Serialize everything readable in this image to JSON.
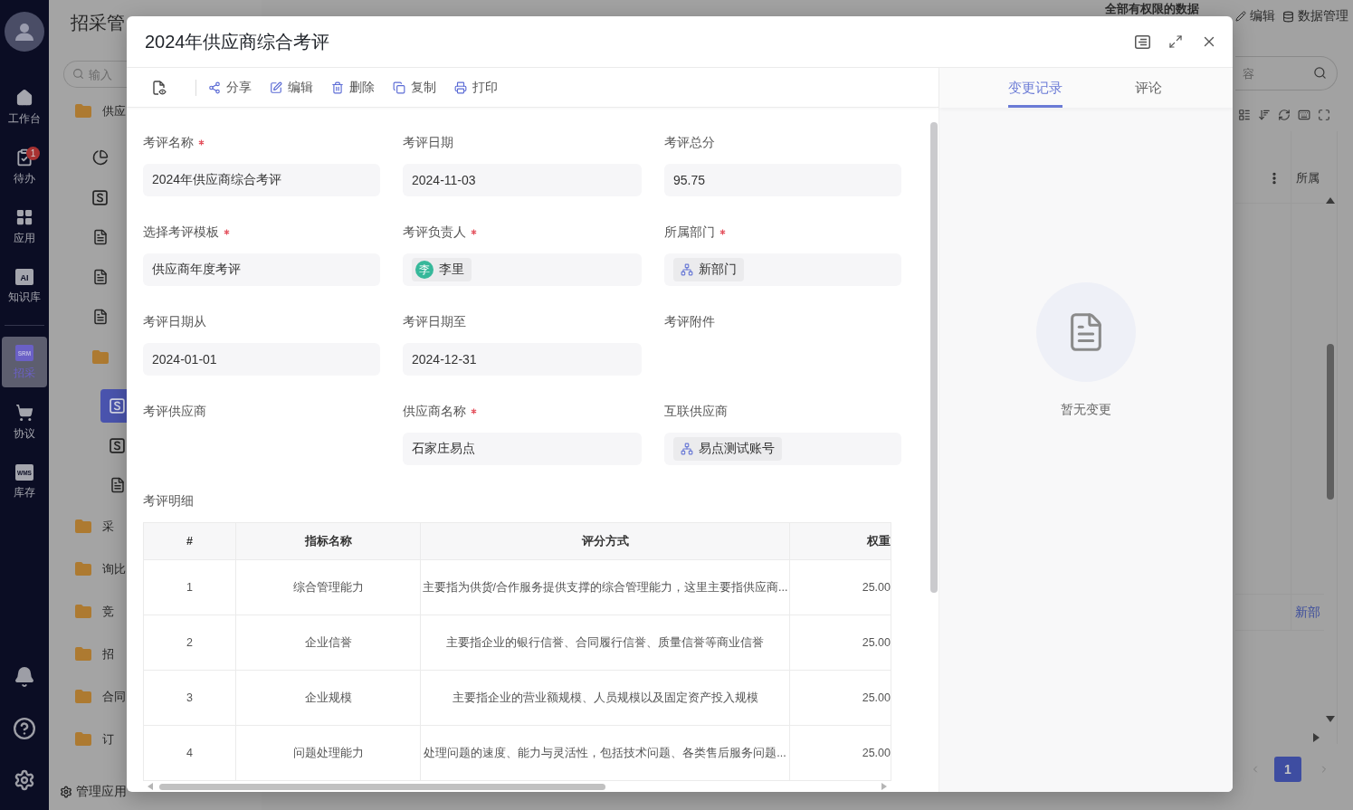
{
  "rail": {
    "groups": [
      [
        {
          "kind": "home",
          "label": "工作台",
          "selected": false
        },
        {
          "kind": "todo",
          "label": "待办",
          "badge": "1",
          "selected": false
        },
        {
          "kind": "apps",
          "label": "应用",
          "selected": false
        },
        {
          "kind": "knowledge",
          "label": "知识库",
          "icon_text": "AI",
          "selected": false
        }
      ],
      [
        {
          "kind": "srm",
          "label": "招采",
          "icon_text": "SRM",
          "selected": true
        },
        {
          "kind": "cart",
          "label": "协议",
          "selected": false
        },
        {
          "kind": "wms",
          "label": "库存",
          "icon_text": "WMS",
          "selected": false
        }
      ]
    ],
    "bottom": [
      {
        "kind": "bell"
      },
      {
        "kind": "help"
      },
      {
        "kind": "settings"
      }
    ]
  },
  "nav": {
    "title": "招采管",
    "search": {
      "placeholder": "输入"
    },
    "tree": [
      {
        "kind": "folder",
        "label": "供应",
        "selected": false,
        "children": [
          {
            "kind": "chart",
            "selected": false
          },
          {
            "kind": "form",
            "selected": false
          },
          {
            "kind": "doc",
            "selected": false
          },
          {
            "kind": "doc",
            "selected": false
          },
          {
            "kind": "doc",
            "selected": false
          },
          {
            "kind": "folder",
            "selected": false,
            "children": [
              {
                "kind": "form",
                "selected": true
              },
              {
                "kind": "form",
                "selected": false
              },
              {
                "kind": "doc",
                "selected": false
              }
            ]
          }
        ]
      },
      {
        "kind": "folder",
        "label": "采",
        "selected": false
      },
      {
        "kind": "folder",
        "label": "询比",
        "selected": false
      },
      {
        "kind": "folder",
        "label": "竞",
        "selected": false
      },
      {
        "kind": "folder",
        "label": "招",
        "selected": false
      },
      {
        "kind": "folder",
        "label": "合同",
        "selected": false
      },
      {
        "kind": "folder",
        "label": "订",
        "selected": false
      }
    ],
    "footer": "管理应用"
  },
  "main": {
    "top_actions": [
      {
        "kind": "scope",
        "label": "全部有权限的数据"
      },
      {
        "kind": "edit",
        "label": "编辑"
      },
      {
        "kind": "data",
        "label": "数据管理"
      }
    ],
    "search": {
      "placeholder": "容"
    },
    "tools": [
      {
        "kind": "group"
      },
      {
        "kind": "sort"
      },
      {
        "kind": "refresh"
      },
      {
        "kind": "keyboard"
      },
      {
        "kind": "fullscreen"
      }
    ],
    "table": {
      "column_1": "所属",
      "cell": "新部"
    },
    "pagination": [
      {
        "label": "1",
        "selected": true
      }
    ]
  },
  "dialog": {
    "title": "2024年供应商综合考评",
    "header_actions": [
      {
        "kind": "outline"
      },
      {
        "kind": "expand"
      },
      {
        "kind": "close"
      }
    ],
    "toolbar": [
      {
        "kind": "preview"
      },
      {
        "kind": "share",
        "label": "分享"
      },
      {
        "kind": "edit",
        "label": "编辑"
      },
      {
        "kind": "delete",
        "label": "删除"
      },
      {
        "kind": "copy",
        "label": "复制"
      },
      {
        "kind": "print",
        "label": "打印"
      }
    ],
    "form": [
      [
        {
          "label": "考评名称",
          "required": true,
          "kind": "text",
          "value": "2024年供应商综合考评"
        },
        {
          "label": "考评日期",
          "required": false,
          "kind": "text",
          "value": "2024-11-03"
        },
        {
          "label": "考评总分",
          "required": false,
          "kind": "text",
          "value": "95.75"
        }
      ],
      [
        {
          "label": "选择考评模板",
          "required": true,
          "kind": "text",
          "value": "供应商年度考评"
        },
        {
          "label": "考评负责人",
          "required": true,
          "kind": "tags",
          "tags": [
            {
              "kind": "user",
              "initial": "李",
              "name": "李里"
            }
          ]
        },
        {
          "label": "所属部门",
          "required": true,
          "kind": "tags",
          "tags": [
            {
              "kind": "org",
              "name": "新部门"
            }
          ]
        }
      ],
      [
        {
          "label": "考评日期从",
          "required": false,
          "kind": "text",
          "value": "2024-01-01"
        },
        {
          "label": "考评日期至",
          "required": false,
          "kind": "text",
          "value": "2024-12-31"
        },
        {
          "label": "考评附件",
          "required": false,
          "kind": "empty"
        }
      ],
      [
        {
          "label": "考评供应商",
          "required": false,
          "kind": "empty"
        },
        {
          "label": "供应商名称",
          "required": true,
          "kind": "text",
          "value": "石家庄易点"
        },
        {
          "label": "互联供应商",
          "required": false,
          "kind": "tags",
          "tags": [
            {
              "kind": "org",
              "name": "易点测试账号"
            }
          ]
        }
      ]
    ],
    "detail": {
      "label": "考评明细",
      "columns": [
        "#",
        "指标名称",
        "评分方式",
        "权重"
      ],
      "rows": [
        [
          "1",
          "综合管理能力",
          "主要指为供货/合作服务提供支撑的综合管理能力，这里主要指供应商...",
          "25.00"
        ],
        [
          "2",
          "企业信誉",
          "主要指企业的银行信誉、合同履行信誉、质量信誉等商业信誉",
          "25.00"
        ],
        [
          "3",
          "企业规模",
          "主要指企业的营业额规模、人员规模以及固定资产投入规模",
          "25.00"
        ],
        [
          "4",
          "问题处理能力",
          "处理问题的速度、能力与灵活性，包括技术问题、各类售后服务问题...",
          "25.00"
        ]
      ]
    },
    "side": {
      "tabs": [
        {
          "label": "变更记录",
          "selected": true
        },
        {
          "label": "评论",
          "selected": false
        }
      ],
      "empty_text": "暂无变更"
    }
  }
}
